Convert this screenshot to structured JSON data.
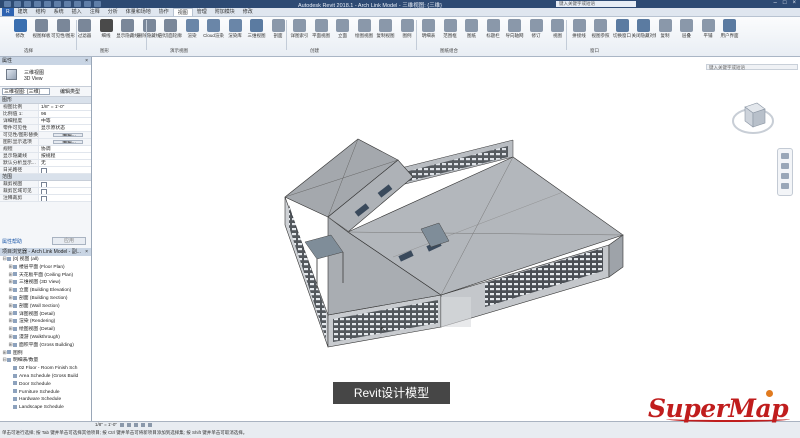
{
  "titlebar": {
    "title": "Autodesk Revit 2018.1 - Arch Link Model - 三维视图: {三维}",
    "search_placeholder": "键入关键字或短语"
  },
  "ribbon_tabs": [
    "建筑",
    "结构",
    "系统",
    "插入",
    "注释",
    "分析",
    "体量和场地",
    "协作",
    "视图",
    "管理",
    "附加模块",
    "修改"
  ],
  "ribbon_active_tab": "视图",
  "ribbon": {
    "buttons": [
      {
        "label": "修改",
        "color": "#3a6fb0"
      },
      {
        "label": "视图样板",
        "color": "#7a8799"
      },
      {
        "label": "可见性/图形",
        "color": "#7a8799"
      },
      {
        "label": "过滤器",
        "color": "#7a8799"
      },
      {
        "label": "细线",
        "color": "#4a4a4a"
      },
      {
        "label": "显示隐藏线",
        "color": "#7a8799"
      },
      {
        "label": "删除隐藏线",
        "color": "#7a8799"
      },
      {
        "label": "剖切面轮廓",
        "color": "#7a8799"
      },
      {
        "label": "渲染",
        "color": "#6a86a8"
      },
      {
        "label": "Cloud渲染",
        "color": "#6a86a8"
      },
      {
        "label": "渲染库",
        "color": "#6a86a8"
      },
      {
        "label": "三维视图",
        "color": "#5b7ba1"
      },
      {
        "label": "剖面",
        "color": "#8a98aa"
      },
      {
        "label": "详图索引",
        "color": "#8a98aa"
      },
      {
        "label": "平面视图",
        "color": "#8a98aa"
      },
      {
        "label": "立面",
        "color": "#8a98aa"
      },
      {
        "label": "绘图视图",
        "color": "#8a98aa"
      },
      {
        "label": "复制视图",
        "color": "#8a98aa"
      },
      {
        "label": "图例",
        "color": "#8a98aa"
      },
      {
        "label": "明细表",
        "color": "#8a98aa"
      },
      {
        "label": "范围框",
        "color": "#8a98aa"
      },
      {
        "label": "图纸",
        "color": "#8a98aa"
      },
      {
        "label": "标题栏",
        "color": "#8a98aa"
      },
      {
        "label": "导向轴网",
        "color": "#8a98aa"
      },
      {
        "label": "修订",
        "color": "#8a98aa"
      },
      {
        "label": "视图",
        "color": "#8a98aa"
      },
      {
        "label": "拼接线",
        "color": "#8a98aa"
      },
      {
        "label": "视图参照",
        "color": "#8a98aa"
      },
      {
        "label": "切换窗口",
        "color": "#5b7ba1"
      },
      {
        "label": "关闭隐藏对象",
        "color": "#5b7ba1"
      },
      {
        "label": "复制",
        "color": "#8a98aa"
      },
      {
        "label": "层叠",
        "color": "#8a98aa"
      },
      {
        "label": "平铺",
        "color": "#8a98aa"
      },
      {
        "label": "用户界面",
        "color": "#5b7ba1"
      }
    ],
    "panels": [
      "选择",
      "图形",
      "演示视图",
      "创建",
      "图纸组合",
      "窗口"
    ]
  },
  "properties": {
    "header": "属性",
    "type_line1": "三维视图",
    "type_line2": "3D View",
    "selector": "三维视图: {三维}",
    "edit_type": "编辑类型",
    "group_graphics": "图形",
    "graphics_rows": [
      {
        "k": "视图比例",
        "v": "1/8\" = 1'-0\""
      },
      {
        "k": "比例值 1:",
        "v": "96"
      },
      {
        "k": "详细程度",
        "v": "中等"
      },
      {
        "k": "零件可见性",
        "v": "显示原状态"
      },
      {
        "k": "可见性/图形替换",
        "v": "编辑..."
      },
      {
        "k": "图形显示选项",
        "v": "编辑..."
      },
      {
        "k": "规程",
        "v": "协调"
      },
      {
        "k": "显示隐藏线",
        "v": "按规程"
      },
      {
        "k": "默认分析显示...",
        "v": "无"
      },
      {
        "k": "日光路径",
        "v": ""
      }
    ],
    "group_extents": "范围",
    "extent_rows": [
      {
        "k": "裁剪视图",
        "v": ""
      },
      {
        "k": "裁剪区域可见",
        "v": ""
      },
      {
        "k": "注释裁剪",
        "v": ""
      }
    ],
    "help": "属性帮助",
    "apply": "应用"
  },
  "browser": {
    "header": "项目浏览器 - Arch Link Model - 副...",
    "items": [
      {
        "t": "[0] 视图 (all)",
        "lvl": 0,
        "ex": "⊟"
      },
      {
        "t": "楼层平面 (Floor Plan)",
        "lvl": 1,
        "ex": "⊞"
      },
      {
        "t": "天花板平面 (Ceiling Plan)",
        "lvl": 1,
        "ex": "⊞"
      },
      {
        "t": "三维视图 (3D View)",
        "lvl": 1,
        "ex": "⊞"
      },
      {
        "t": "立面 (Building Elevation)",
        "lvl": 1,
        "ex": "⊞"
      },
      {
        "t": "剖面 (Building Section)",
        "lvl": 1,
        "ex": "⊞"
      },
      {
        "t": "剖面 (Wall Section)",
        "lvl": 1,
        "ex": "⊞"
      },
      {
        "t": "详图视图 (Detail)",
        "lvl": 1,
        "ex": "⊞"
      },
      {
        "t": "渲染 (Rendering)",
        "lvl": 1,
        "ex": "⊞"
      },
      {
        "t": "绘图视图 (Detail)",
        "lvl": 1,
        "ex": "⊞"
      },
      {
        "t": "漫游 (Walkthrough)",
        "lvl": 1,
        "ex": "⊞"
      },
      {
        "t": "面积平面 (Gross Building)",
        "lvl": 1,
        "ex": "⊞"
      },
      {
        "t": "图例",
        "lvl": 0,
        "ex": "⊞"
      },
      {
        "t": "明细表/数量",
        "lvl": 0,
        "ex": "⊟"
      },
      {
        "t": "02 Floor - Room Finish Sch",
        "lvl": 1,
        "ex": ""
      },
      {
        "t": "Area Schedule (Gross Build",
        "lvl": 1,
        "ex": ""
      },
      {
        "t": "Door Schedule",
        "lvl": 1,
        "ex": ""
      },
      {
        "t": "Furniture Schedule",
        "lvl": 1,
        "ex": ""
      },
      {
        "t": "Hardware Schedule",
        "lvl": 1,
        "ex": ""
      },
      {
        "t": "Landscape Schedule",
        "lvl": 1,
        "ex": ""
      }
    ]
  },
  "viewbar": {
    "scale": "1/8\" = 1'-0\""
  },
  "status": {
    "text": "单击可进行选择; 按 Tab 键并单击可选择其他项目; 按 Ctrl 键并单击可将新项目添加到选择集; 按 Shift 键并单击可取消选择。"
  },
  "caption": "Revit设计模型",
  "logo": "SuperMap",
  "viewcube": {
    "face": "前"
  }
}
